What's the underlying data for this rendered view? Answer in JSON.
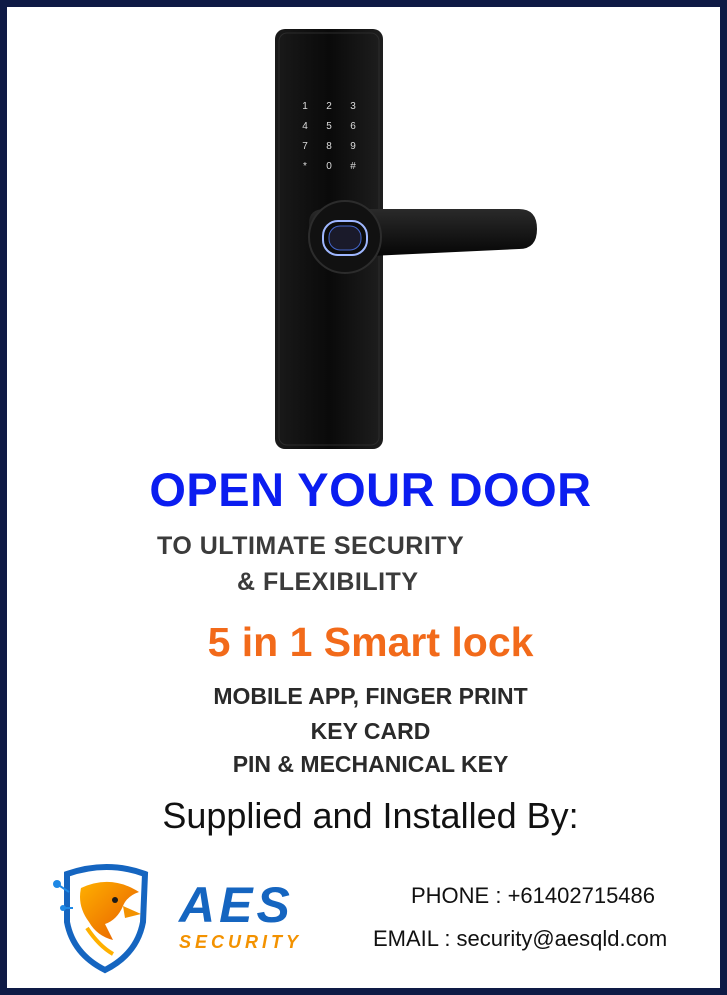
{
  "lock": {
    "keypad_keys": [
      "1",
      "2",
      "3",
      "4",
      "5",
      "6",
      "7",
      "8",
      "9",
      "*",
      "0",
      "#"
    ]
  },
  "headline": "OPEN YOUR DOOR",
  "subheadline_line1": "TO ULTIMATE SECURITY",
  "subheadline_line2": "& FLEXIBILITY",
  "product": "5 in 1 Smart lock",
  "features": {
    "line1": "MOBILE APP, FINGER PRINT",
    "line2": "KEY CARD",
    "line3": "PIN & MECHANICAL KEY"
  },
  "supplied_by": "Supplied and Installed By:",
  "logo": {
    "brand": "AES",
    "tagline": "SECURITY"
  },
  "contact": {
    "phone": "PHONE : +61402715486",
    "email": "EMAIL : security@aesqld.com"
  },
  "colors": {
    "headline": "#0b1df0",
    "product": "#f26a1a",
    "frame": "#0e1a45",
    "logo_blue": "#1565c0",
    "logo_orange": "#f39200"
  }
}
